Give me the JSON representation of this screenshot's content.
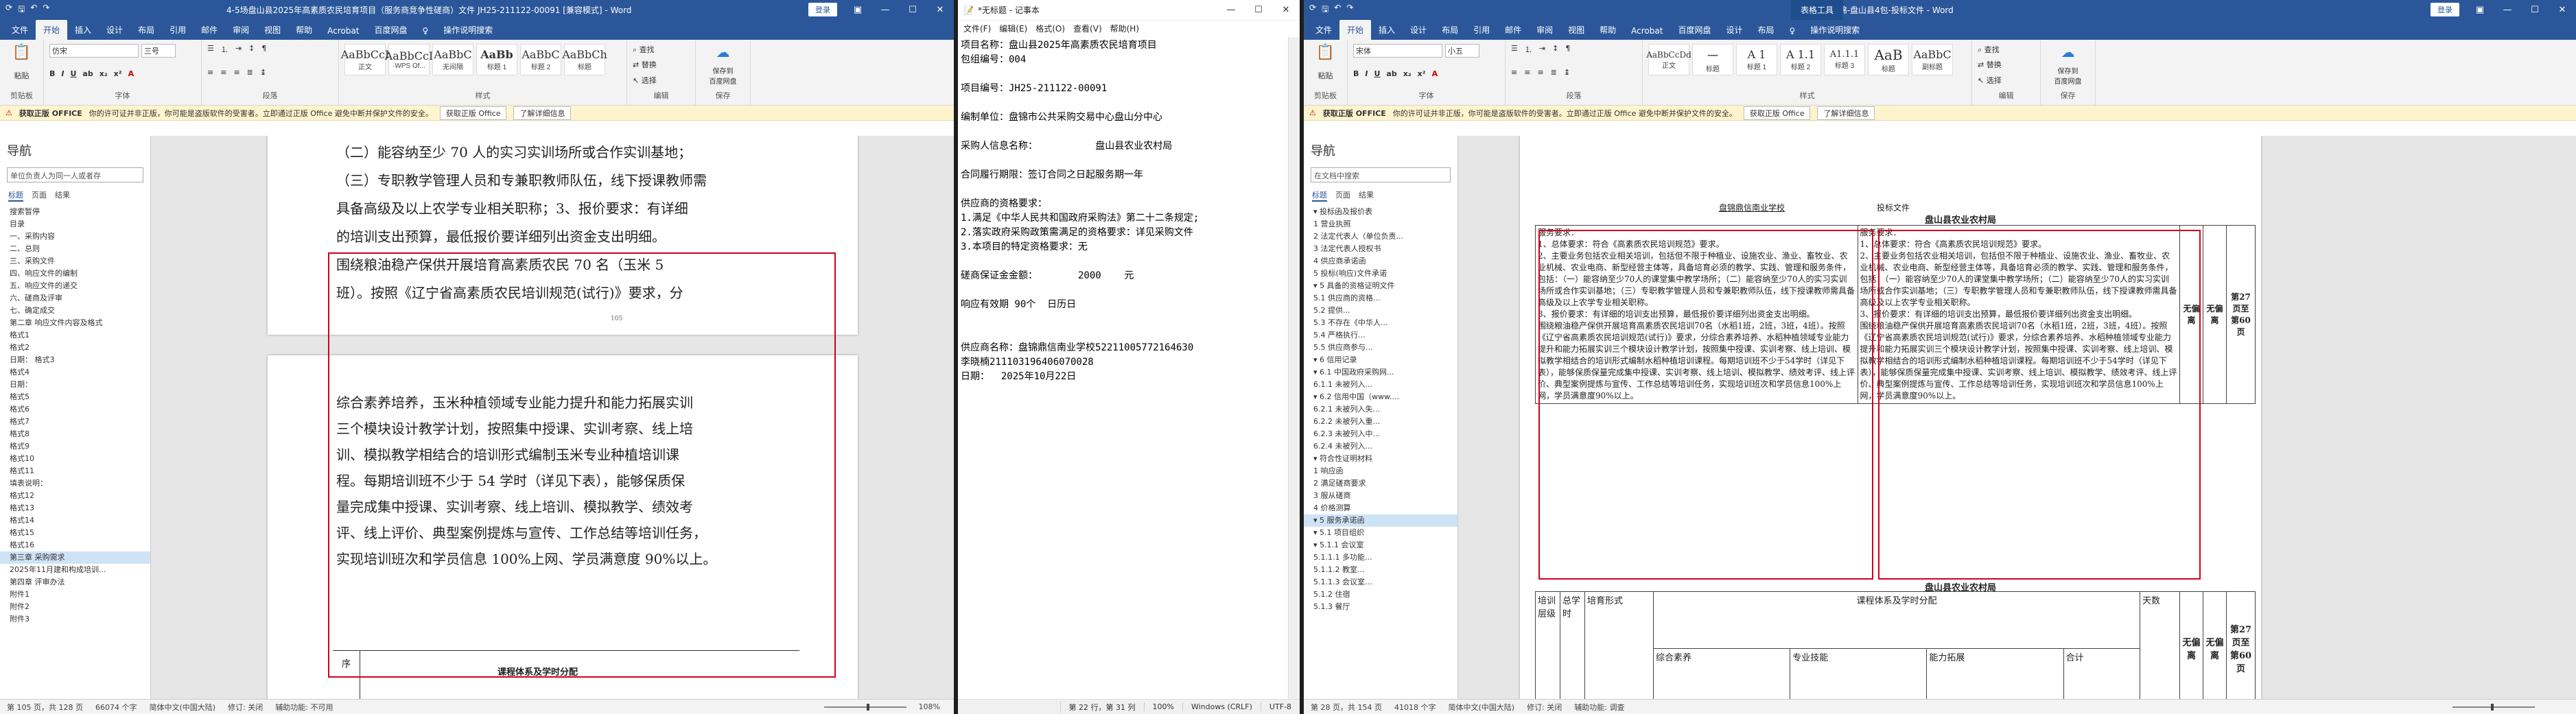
{
  "win1": {
    "title": "4-5场盘山县2025年高素质农民培育项目（服务商竞争性磋商）文件  JH25-211122-00091 [兼容模式] - Word",
    "signin": "登录",
    "tabs": [
      "文件",
      "开始",
      "插入",
      "设计",
      "布局",
      "引用",
      "邮件",
      "审阅",
      "视图",
      "帮助",
      "Acrobat",
      "百度网盘",
      "♀",
      "操作说明搜索"
    ],
    "active_tab": "开始",
    "ribbon": {
      "paste": "粘贴",
      "clipboard": "剪贴板",
      "font_name": "仿宋",
      "font_size": "三号",
      "font_group": "字体",
      "para_group": "段落",
      "styles": [
        {
          "preview": "AaBbCcI",
          "name": "正文"
        },
        {
          "preview": "AaBbCcI",
          "name": "·WPS Of..."
        },
        {
          "preview": "AaBbC",
          "name": "无间隔"
        },
        {
          "preview": "AaBb",
          "name": "标题 1"
        },
        {
          "preview": "AaBbC",
          "name": "标题 2"
        },
        {
          "preview": "AaBbCh",
          "name": "标题"
        }
      ],
      "styles_group": "样式",
      "find": "查找",
      "replace": "替换",
      "select": "选择",
      "edit_group": "编辑",
      "save_baidu": "保存到\n百度网盘",
      "save_group": "保存"
    },
    "infobar": {
      "label": "获取正版 OFFICE",
      "text": "你的许可证并非正版，你可能是盗版软件的受害者。立即通过正版 Office 避免中断并保护文件的安全。",
      "btn1": "获取正版 Office",
      "btn2": "了解详细信息"
    },
    "nav": {
      "title": "导航",
      "search": "单位负责人为同一人或者存",
      "tabs": [
        "标题",
        "页面",
        "结果"
      ],
      "items": [
        "搜索暂停",
        "目录",
        "一、采购内容",
        "二、总则",
        "三、采购文件",
        "四、响应文件的编制",
        "五、响应文件的递交",
        "六、磋商及评审",
        "七、确定成交",
        "第二章 响应文件内容及格式",
        "格式1",
        "格式2",
        "日期：  格式3",
        "格式4",
        "日期：",
        "格式5",
        "格式6",
        "格式7",
        "格式8",
        "格式9",
        "格式10",
        "格式11",
        "填表说明：",
        "格式12",
        "格式13",
        "格式14",
        "格式15",
        "格式16",
        "第三章  采购需求",
        "2025年11月建和构成培训...",
        "第四章  评审办法",
        "附件1",
        "附件2",
        "附件3"
      ],
      "selected": 28
    },
    "page1": {
      "lines": [
        "（二）能容纳至少 70 人的实习实训场所或合作实训基地；",
        "（三）专职教学管理人员和专兼职教师队伍，线下授课教师需",
        "具备高级及以上农学专业相关职称；3、报价要求：有详细",
        "的培训支出预算，最低报价要详细列出资金支出明细。",
        "围绕粮油稳产保供开展培育高素质农民 70 名（玉米 5",
        "班）。按照《辽宁省高素质农民培训规范(试行)》要求，分"
      ],
      "page_no": "105"
    },
    "page2": {
      "lines": [
        "综合素养培养，玉米种植领域专业能力提升和能力拓展实训",
        "三个模块设计教学计划，按照集中授课、实训考察、线上培",
        "训、模拟教学相结合的培训形式编制玉米专业种植培训课",
        "程。每期培训班不少于 54 学时（详见下表），能够保质保",
        "量完成集中授课、实训考察、线上培训、模拟教学、绩效考",
        "评、线上评价、典型案例提炼与宣传、工作总结等培训任务，",
        "实现培训班次和学员信息 100%上网、学员满意度 90%以上。"
      ],
      "table_head": "序",
      "table_title": "课程体系及学时分配"
    },
    "status": {
      "page": "第 105 页，共 128 页",
      "words": "66074 个字",
      "lang": "简体中文(中国大陆)",
      "track": "修订: 关闭",
      "access": "辅助功能: 不可用",
      "zoom": "108%"
    }
  },
  "win2": {
    "title": "*无标题 - 记事本",
    "menu": [
      "文件(F)",
      "编辑(E)",
      "格式(O)",
      "查看(V)",
      "帮助(H)"
    ],
    "lines": [
      "项目名称：盘山县2025年高素质农民培育项目",
      "包组编号：004",
      "",
      "项目编号：JH25-211122-00091",
      "",
      "编制单位：盘锦市公共采购交易中心盘山分中心",
      "",
      "采购人信息名称：          盘山县农业农村局",
      "",
      "合同履行期限：签订合同之日起服务期一年",
      "",
      "供应商的资格要求：",
      "1.满足《中华人民共和国政府采购法》第二十二条规定;",
      "2.落实政府采购政策需满足的资格要求：详见采购文件",
      "3.本项目的特定资格要求：无",
      "",
      "磋商保证金金额：       2000    元",
      "",
      "响应有效期 90个  日历日",
      "",
      "",
      "供应商名称：盘锦鼎信南业学校52211005772164630",
      "李晓楠2111031964060700​28",
      "日期：  2025年10月22日"
    ],
    "status": {
      "pos": "第 22 行，第 31 列",
      "zoom": "100%",
      "eol": "Windows (CRLF)",
      "enc": "UTF-8"
    }
  },
  "win3": {
    "title": "盘锦-盘山县4包-投标文件 - Word",
    "context_label": "表格工具",
    "signin": "登录",
    "tabs": [
      "文件",
      "开始",
      "插入",
      "设计",
      "布局",
      "引用",
      "邮件",
      "审阅",
      "视图",
      "帮助",
      "Acrobat",
      "百度网盘",
      "设计",
      "布局",
      "♀",
      "操作说明搜索"
    ],
    "active_tab": "开始",
    "ribbon": {
      "paste": "粘贴",
      "clipboard": "剪贴板",
      "font_name": "宋体",
      "font_size": "小五",
      "font_group": "字体",
      "para_group": "段落",
      "styles": [
        {
          "preview": "AaBbCcDd",
          "name": "正文"
        },
        {
          "preview": "一",
          "name": "标题"
        },
        {
          "preview": "A 1",
          "name": "标题 1"
        },
        {
          "preview": "A 1.1",
          "name": "标题 2"
        },
        {
          "preview": "A1.1.1",
          "name": "标题 3"
        },
        {
          "preview": "AaB",
          "name": "标题"
        },
        {
          "preview": "AaBbC",
          "name": "副标题"
        }
      ],
      "styles_group": "样式",
      "find": "查找",
      "replace": "替换",
      "select": "选择",
      "edit_group": "编辑",
      "save_baidu": "保存到\n百度网盘",
      "save_group": "保存"
    },
    "infobar": {
      "label": "获取正版 OFFICE",
      "text": "你的许可证并非正版，你可能是盗版软件的受害者。立即通过正版 Office 避免中断并保护文件的安全。",
      "btn1": "获取正版 Office",
      "btn2": "了解详细信息"
    },
    "nav": {
      "title": "导航",
      "search": "在文档中搜索",
      "tabs": [
        "标题",
        "页面",
        "结果"
      ],
      "items": [
        "▾ 投标函及报价表",
        "1 营业执照",
        "2 法定代表人（单位负责...",
        "3 法定代表人授权书",
        "4 供应商承诺函",
        "5 投标(响应)文件承诺",
        "▾ 5 具备的资格证明文件",
        "5.1 供应商的资格...",
        "5.2 提供...",
        "5.3 不存在《中华人...",
        "5.4 严格执行...",
        "5.5 供应商参与...",
        "▾ 6 信用记录",
        "▾ 6.1 中国政府采购网...",
        "6.1.1 未被列入...",
        "▾ 6.2 信用中国（www....",
        "6.2.1 未被列入失...",
        "6.2.2 未被列入重...",
        "6.2.3 未被列入中...",
        "6.2.4 未被列入...",
        "▾ 符合性证明材料",
        "1 响应函",
        "2 满足磋商要求",
        "3 服从磋商",
        "4 价格测算",
        "▾ 5 服务承诺函",
        "▾ 5.1 项目组织",
        "▾ 5.1.1 会议室",
        "5.1.1.1 多功能...",
        "5.1.1.2 教室...",
        "5.1.1.3 会议室...",
        "5.1.2 住宿",
        "5.1.3 餐厅"
      ],
      "selected": 25
    },
    "doc": {
      "header_left": "盘锦鼎信南业学校",
      "header_right": "投标文件",
      "col_head": "盘山县农业农村局",
      "left_cell": [
        "服务要求：",
        "1、总体要求：符合《高素质农民培训规范》要求。",
        "2、主要业务包括农业相关培训，包括但不限于种植业、设施农业、渔业、畜牧业、农业机械、农业电商、新型经营主体等，具备培育必须的教学、实践、管理和服务条件，包括：（一）能容纳至少70人的课堂集中教学场所；（二）能容纳至少70人的实习实训场所或合作实训基地；（三）专职教学管理人员和专兼职教师队伍，线下授课教师需具备高级及以上农学专业相关职称。",
        "3、报价要求：有详细的培训支出预算，最低报价要详细列出资金支出明细。",
        "围绕粮油稳产保供开展培育高素质农民培训70名（水稻1班，2班，3班，4班）。按照《辽宁省高素质农民培训规范(试行)》要求，分综合素养培养、水稻种植领域专业能力提升和能力拓展实训三个模块设计教学计划，按照集中授课、实训考察、线上培训、模拟教学相结合的培训形式编制水稻种植培训课程。每期培训班不少于54学时（详见下表），能够保质保量完成集中授课、实训考察、线上培训、模拟教学、绩效考评、线上评价、典型案例提炼与宣传、工作总结等培训任务，实现培训班次和学员信息100%上网，学员满意度90%以上。"
      ],
      "right_cell": [
        "服务要求：",
        "1、总体要求：符合《高素质农民培训规范》要求。",
        "2、主要业务包括农业相关培训，包括但不限于种植业、设施农业、渔业、畜牧业、农业机械、农业电商、新型经营主体等，具备培育必须的教学、实践、管理和服务条件，包括：（一）能容纳至少70人的课堂集中教学场所；（二）能容纳至少70人的实习实训场所或合作实训基地；（三）专职教学管理人员和专兼职教师队伍，线下授课教师需具备高级及以上农学专业相关职称。",
        "3、报价要求：有详细的培训支出预算，最低报价要详细列出资金支出明细。",
        "围绕粮油稳产保供开展培育高素质农民培训70名（水稻1班，2班，3班，4班）。按照《辽宁省高素质农民培训规范(试行)》要求，分综合素养培养、水稻种植领域专业能力提升和能力拓展实训三个模块设计教学计划，按照集中授课、实训考察、线上培训、模拟教学相结合的培训形式编制水稻种植培训课程。每期培训班不少于54学时（详见下表），能够保质保量完成集中授课、实训考察、线上培训、模拟教学、绩效考评、线上评价、典型案例提炼与宣传、工作总结等培训任务，实现培训班次和学员信息100%上网，学员满意度90%以上。"
      ],
      "dev1": "无偏离",
      "dev2": "无偏离",
      "ref": "第27页至第60页",
      "sub_head": "盘山县农业农村局",
      "tbl2": {
        "c1": "培训层级",
        "c2": "总学时",
        "c3": "培育形式",
        "c4": "课程体系及学时分配",
        "c5": "天数",
        "s1": "综合素养",
        "s2": "专业技能",
        "s3": "能力拓展",
        "s4": "合计"
      }
    },
    "status": {
      "page": "第 28 页，共 154 页",
      "words": "41018 个字",
      "lang": "简体中文(中国大陆)",
      "track": "修订: 关闭",
      "access": "辅助功能: 调查"
    }
  }
}
